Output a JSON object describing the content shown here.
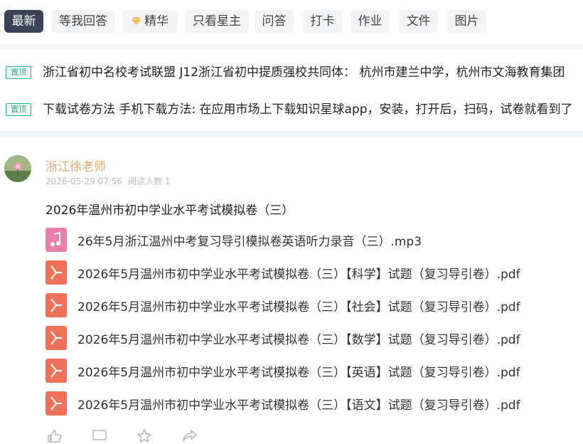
{
  "tabs": [
    {
      "label": "最新",
      "active": true
    },
    {
      "label": "等我回答"
    },
    {
      "label": "精华",
      "icon": "gem-icon"
    },
    {
      "label": "只看星主"
    },
    {
      "label": "问答"
    },
    {
      "label": "打卡"
    },
    {
      "label": "作业"
    },
    {
      "label": "文件"
    },
    {
      "label": "图片"
    }
  ],
  "pinned": [
    {
      "badge": "置顶",
      "text": "浙江省初中名校考试联盟 J12浙江省初中提质强校共同体： 杭州市建兰中学，杭州市文海教育集团"
    },
    {
      "badge": "置顶",
      "text": "下载试卷方法 手机下载方法: 在应用市场上下载知识星球app，安装，打开后，扫码，试卷就看到了"
    }
  ],
  "post": {
    "author": "浙江徐老师",
    "timestamp": "2026-05-29 07:56",
    "readers": "阅读人数 1",
    "title": "2026年温州市初中学业水平考试模拟卷（三）",
    "files": [
      {
        "type": "audio",
        "name": "26年5月浙江温州中考复习导引模拟卷英语听力录音（三）.mp3"
      },
      {
        "type": "pdf",
        "name": "2026年5月温州市初中学业水平考试模拟卷（三）【科学】试题（复习导引卷）.pdf"
      },
      {
        "type": "pdf",
        "name": "2026年5月温州市初中学业水平考试模拟卷（三）【社会】试题（复习导引卷）.pdf"
      },
      {
        "type": "pdf",
        "name": "2026年5月温州市初中学业水平考试模拟卷（三）【数学】试题（复习导引卷）.pdf"
      },
      {
        "type": "pdf",
        "name": "2026年5月温州市初中学业水平考试模拟卷（三）【英语】试题（复习导引卷）.pdf"
      },
      {
        "type": "pdf",
        "name": "2026年5月温州市初中学业水平考试模拟卷（三）【语文】试题（复习导引卷）.pdf"
      }
    ]
  },
  "colors": {
    "active_tab": "#3c4257",
    "author": "#e7a96c",
    "pin_badge": "#2fae86",
    "pdf_icon": "#f1705a",
    "audio_icon": "#e77fa9"
  }
}
